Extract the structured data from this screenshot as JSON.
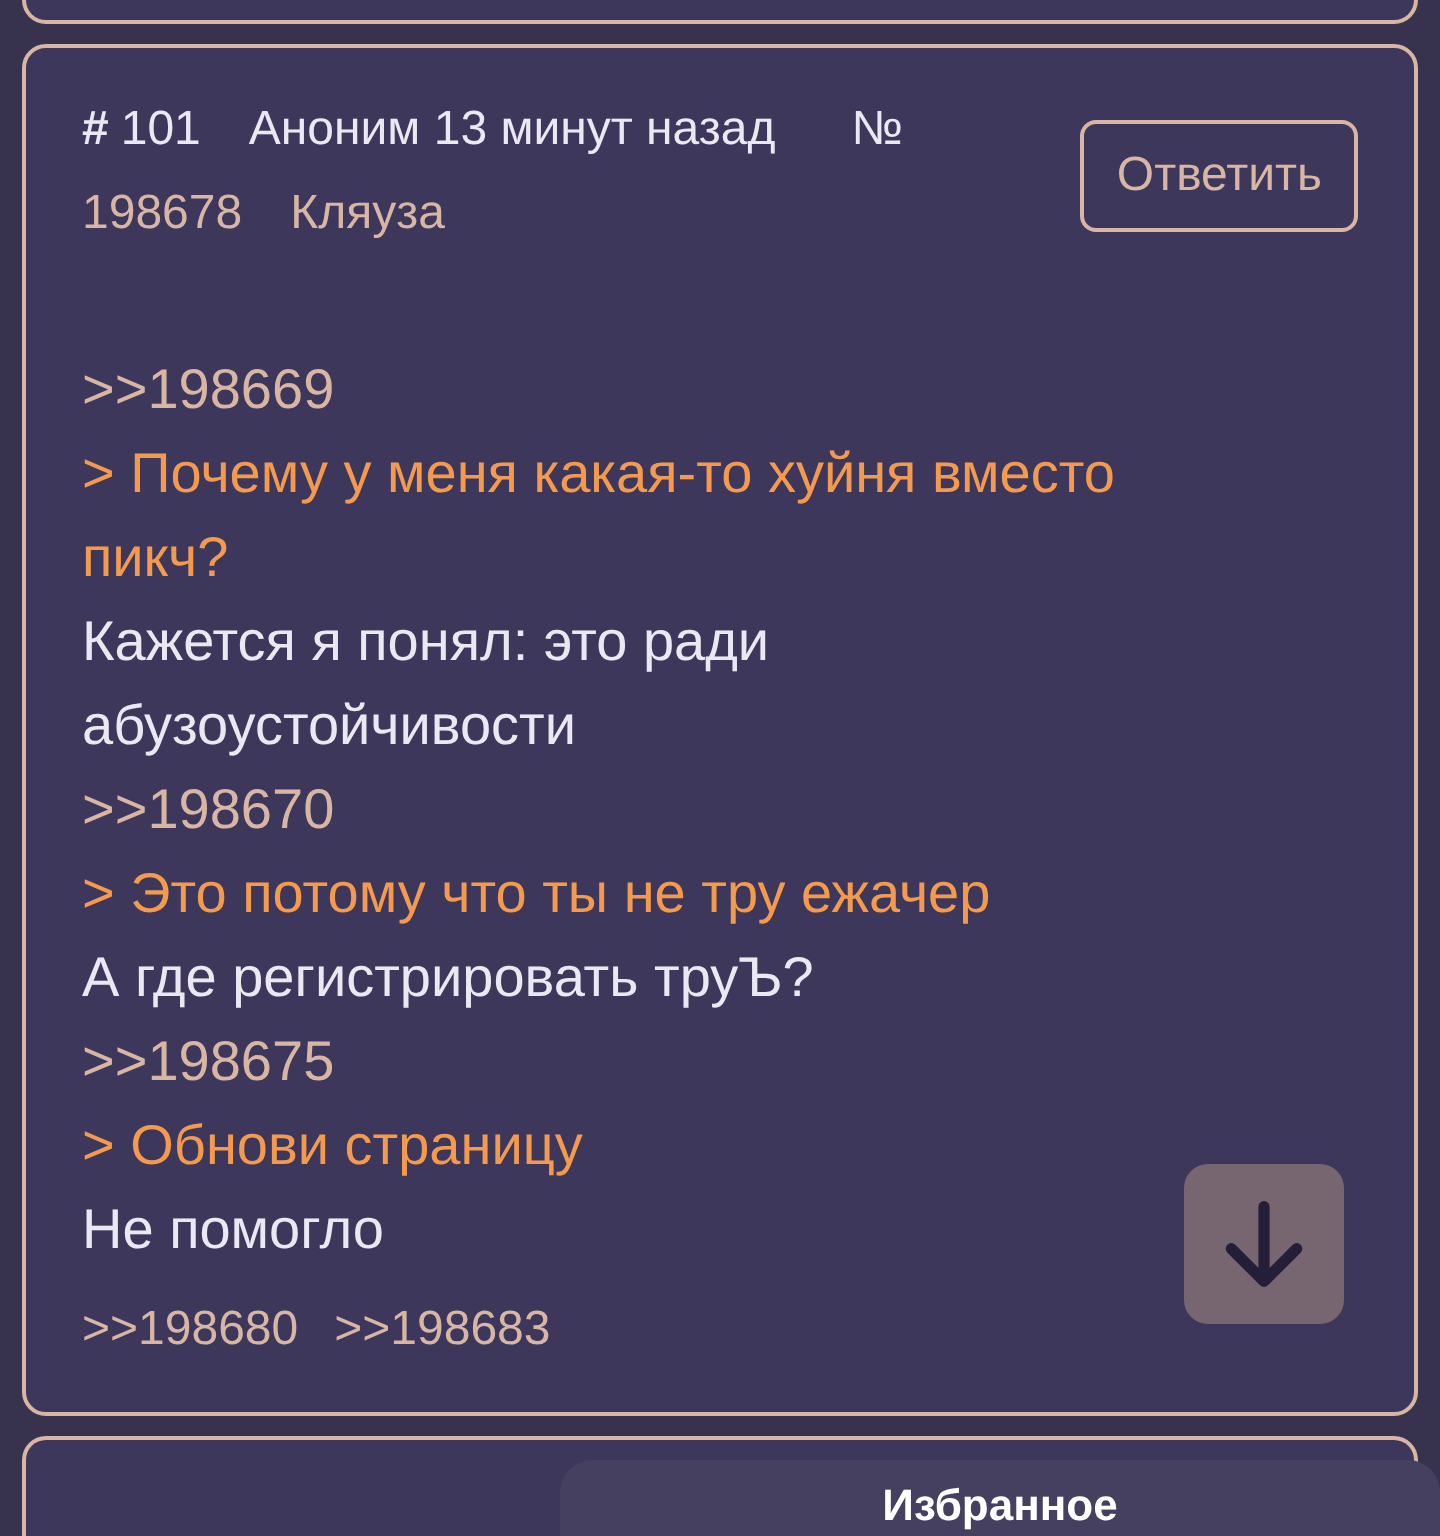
{
  "post": {
    "number_sign": "#",
    "number": "101",
    "author": "Аноним",
    "time": "13 минут назад",
    "no_sign": "№",
    "post_id": "198678",
    "tag": "Кляуза",
    "reply_button": "Ответить",
    "lines": [
      {
        "kind": "link",
        "text": ">>198669"
      },
      {
        "kind": "quote",
        "text": "> Почему у меня какая-то хуйня вместо пикч?"
      },
      {
        "kind": "text",
        "text": "Кажется я понял: это ради абузоустойчивости"
      },
      {
        "kind": "link",
        "text": ">>198670"
      },
      {
        "kind": "quote",
        "text": "> Это потому что ты не тру ежачер"
      },
      {
        "kind": "text",
        "text": "А где регистрировать труЪ?"
      },
      {
        "kind": "link",
        "text": ">>198675"
      },
      {
        "kind": "quote",
        "text": "> Обнови страницу"
      },
      {
        "kind": "text",
        "text": "Не помогло"
      }
    ],
    "replies": [
      ">>198680",
      ">>198683"
    ]
  },
  "favorites_tab": "Избранное"
}
